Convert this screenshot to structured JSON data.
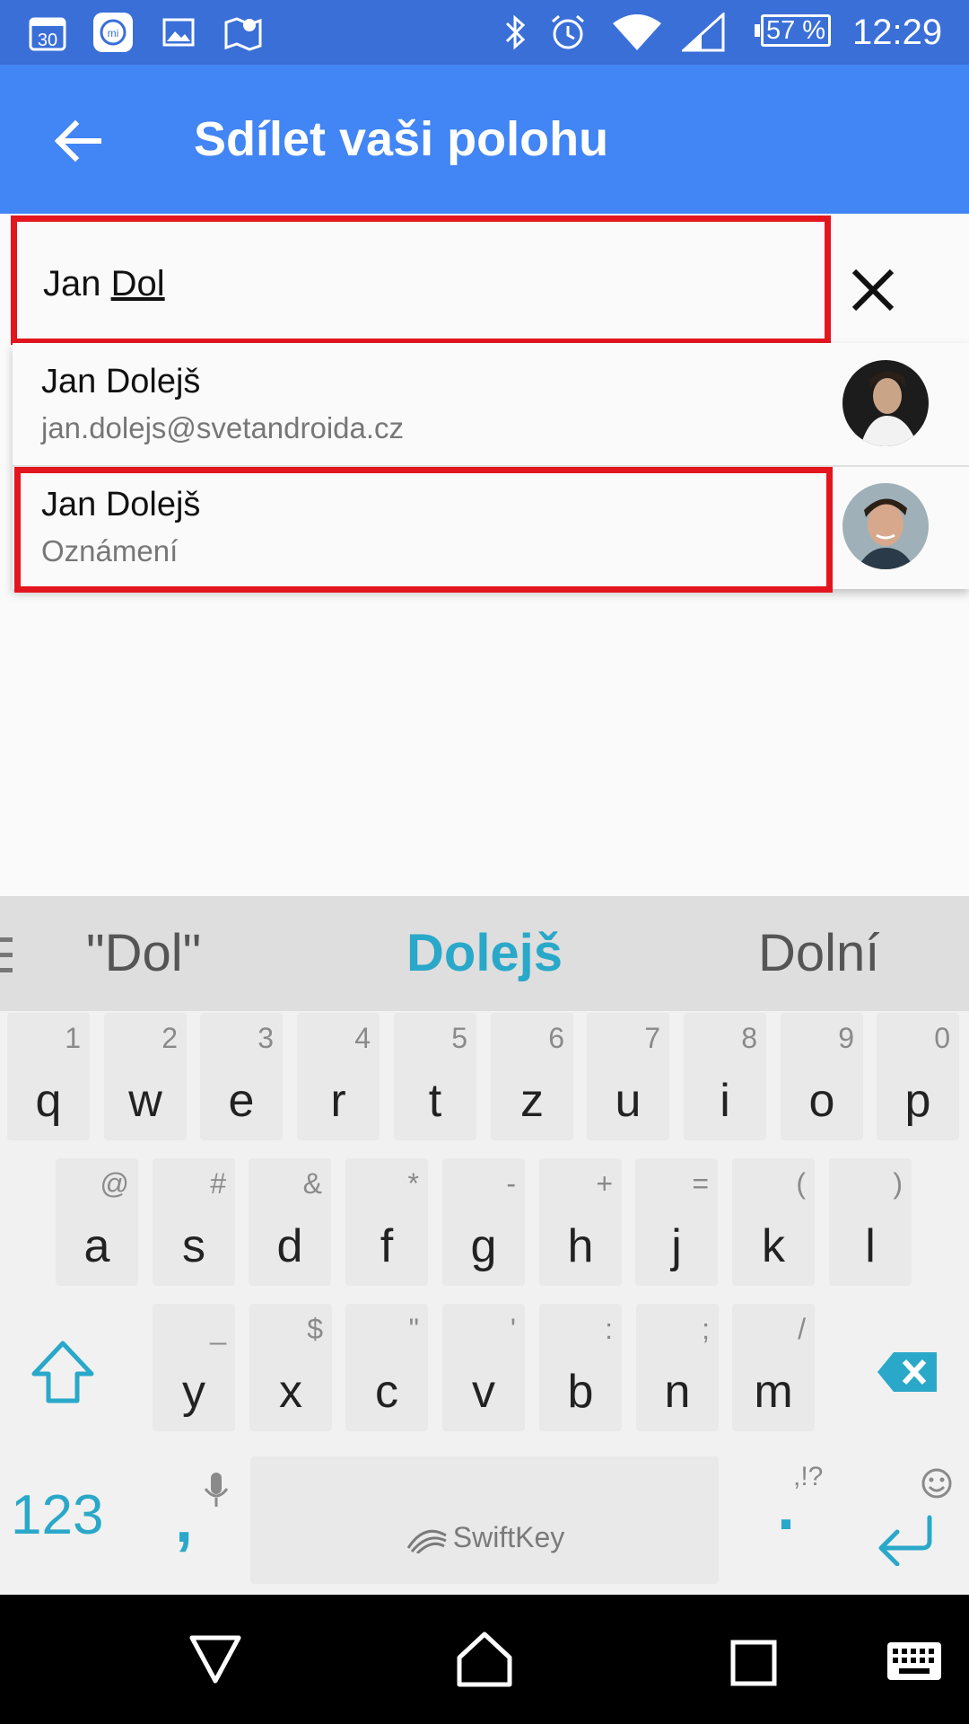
{
  "status_bar": {
    "icons": [
      "calendar-icon",
      "mi-icon",
      "gallery-icon",
      "maps-icon",
      "bluetooth-icon",
      "alarm-icon",
      "wifi-icon",
      "signal-icon"
    ],
    "calendar_day": "30",
    "mi_text": "mi",
    "battery": "57 %",
    "time": "12:29"
  },
  "app_bar": {
    "title": "Sdílet vaši polohu",
    "back_icon": "arrow-back-icon"
  },
  "search": {
    "value_plain": "Jan ",
    "value_underlined": "Dol",
    "clear_icon": "close-icon"
  },
  "suggestions": [
    {
      "name": "Jan Dolejš",
      "detail": "jan.dolejs@svetandroida.cz"
    },
    {
      "name": "Jan Dolejš",
      "detail": "Oznámení"
    }
  ],
  "keyboard": {
    "predictions": [
      "\"Dol\"",
      "Dolejš",
      "Dolní"
    ],
    "row1": [
      {
        "k": "q",
        "h": "1"
      },
      {
        "k": "w",
        "h": "2"
      },
      {
        "k": "e",
        "h": "3"
      },
      {
        "k": "r",
        "h": "4"
      },
      {
        "k": "t",
        "h": "5"
      },
      {
        "k": "z",
        "h": "6"
      },
      {
        "k": "u",
        "h": "7"
      },
      {
        "k": "i",
        "h": "8"
      },
      {
        "k": "o",
        "h": "9"
      },
      {
        "k": "p",
        "h": "0"
      }
    ],
    "row2": [
      {
        "k": "a",
        "h": "@"
      },
      {
        "k": "s",
        "h": "#"
      },
      {
        "k": "d",
        "h": "&"
      },
      {
        "k": "f",
        "h": "*"
      },
      {
        "k": "g",
        "h": "-"
      },
      {
        "k": "h",
        "h": "+"
      },
      {
        "k": "j",
        "h": "="
      },
      {
        "k": "k",
        "h": "("
      },
      {
        "k": "l",
        "h": ")"
      }
    ],
    "row3": [
      {
        "k": "y",
        "h": "_"
      },
      {
        "k": "x",
        "h": "$"
      },
      {
        "k": "c",
        "h": "\""
      },
      {
        "k": "v",
        "h": "'"
      },
      {
        "k": "b",
        "h": ":"
      },
      {
        "k": "n",
        "h": ";"
      },
      {
        "k": "m",
        "h": "/"
      }
    ],
    "numbers_key": "123",
    "comma_key": ",",
    "period_key": ".",
    "punct_hint": ",!?",
    "space_brand": "SwiftKey",
    "accent_color": "#2aa8c9"
  },
  "nav_bar": {
    "icons": [
      "back-triangle-icon",
      "home-icon",
      "recents-icon",
      "keyboard-icon"
    ]
  }
}
